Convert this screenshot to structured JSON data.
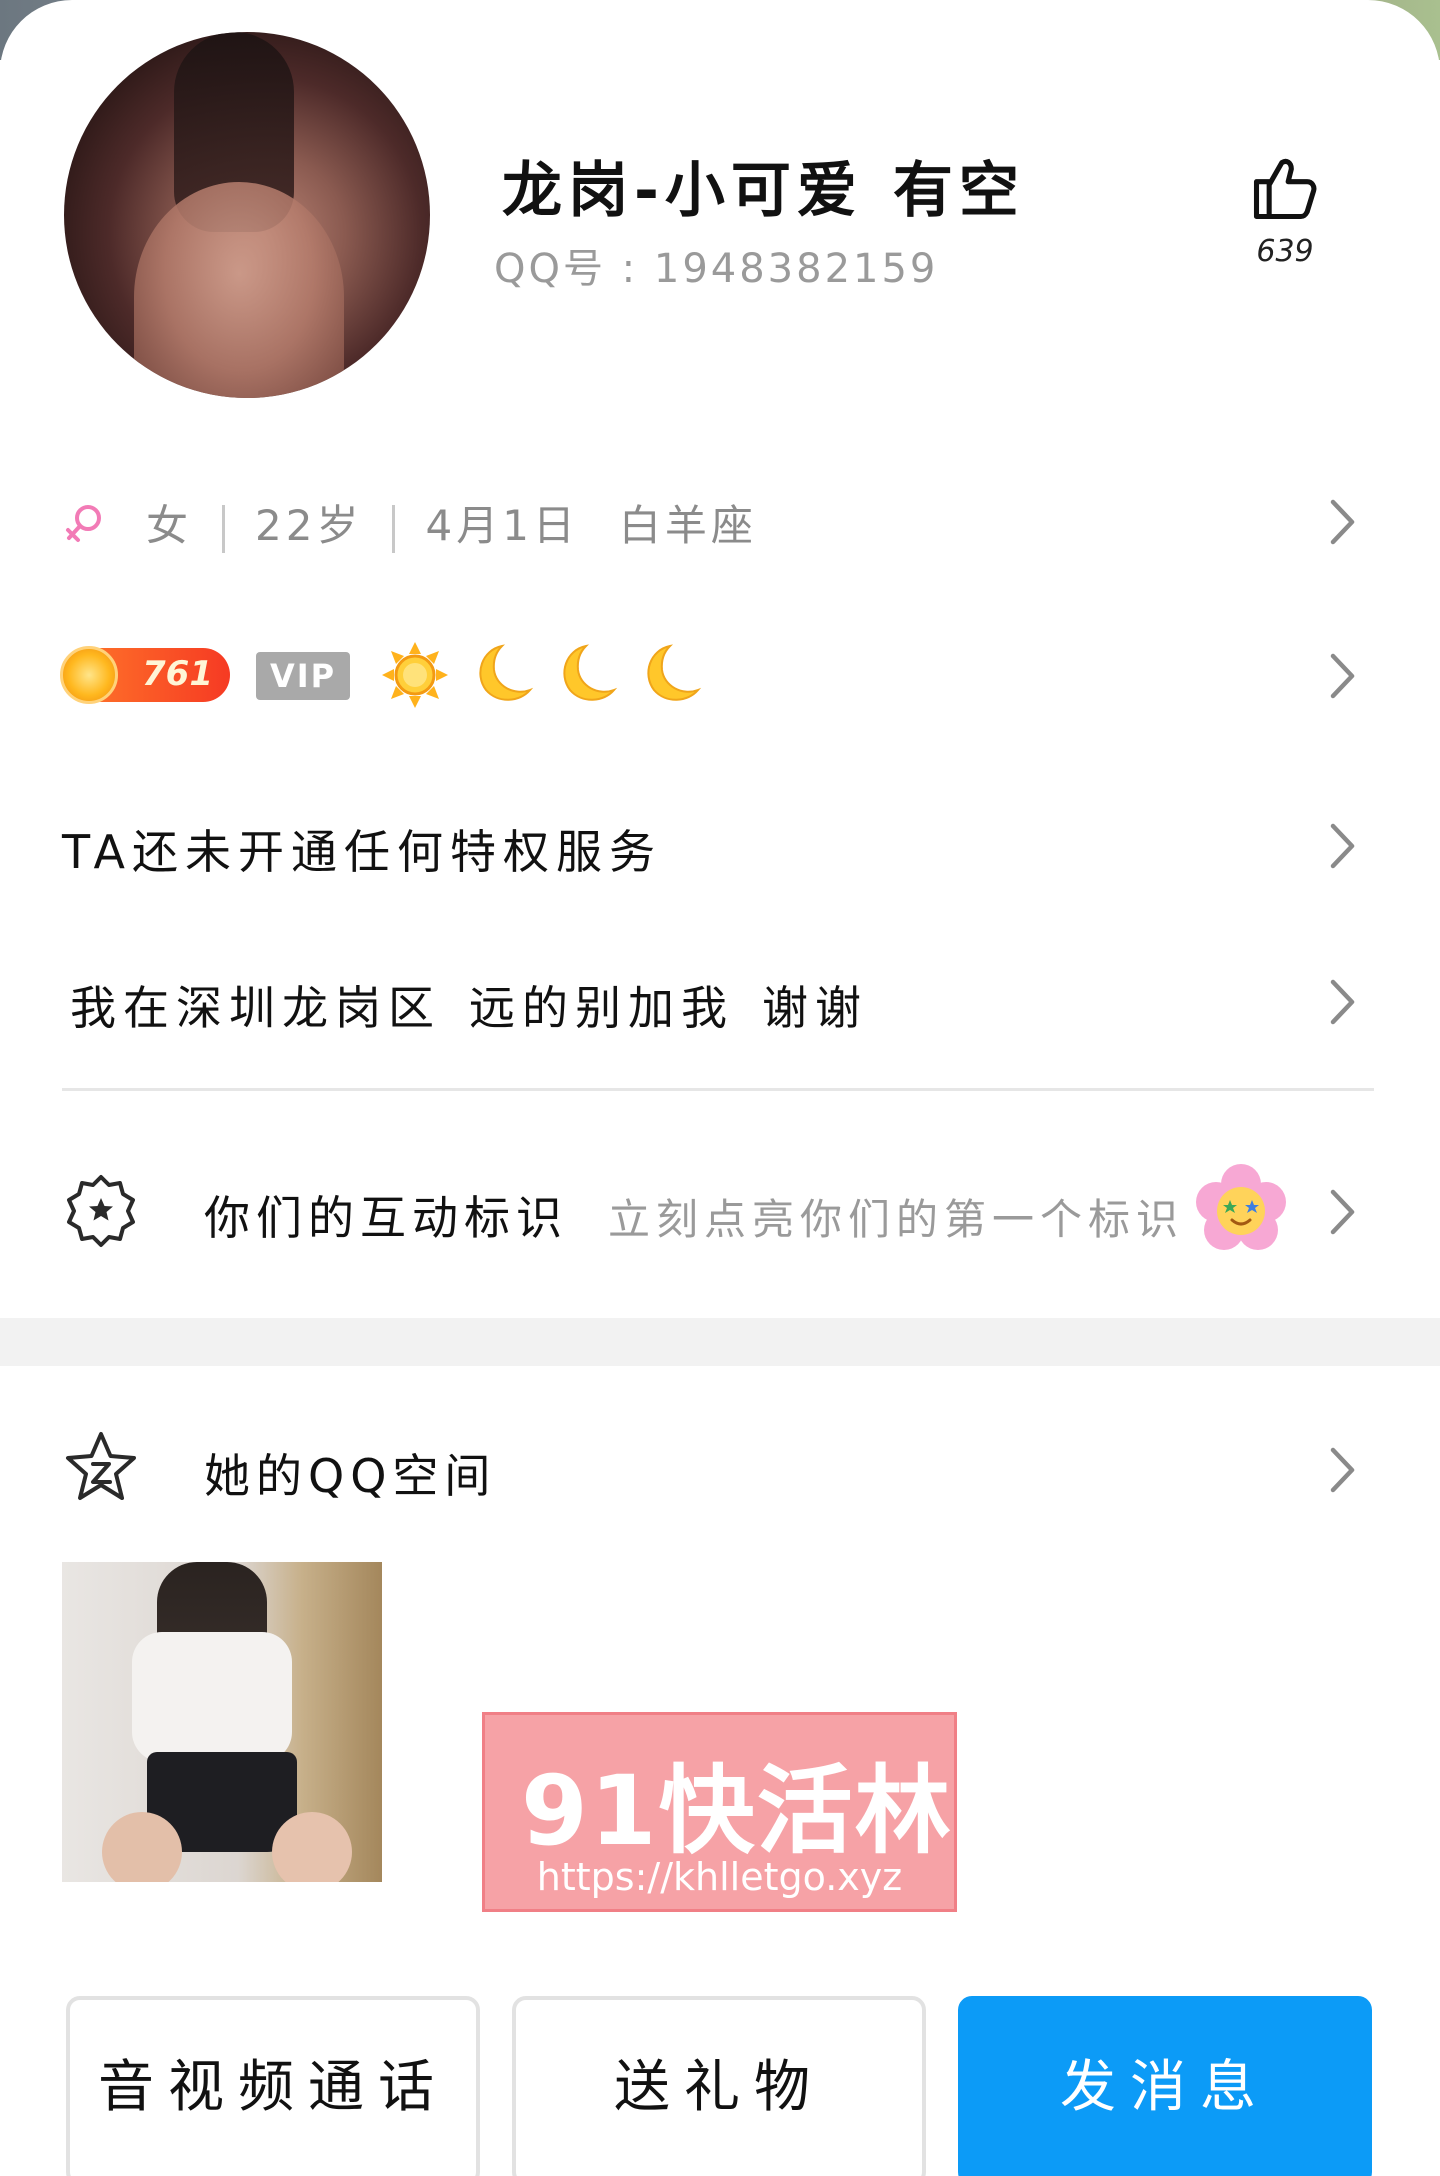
{
  "profile": {
    "name_part1": "龙岗-小可爱",
    "name_part2": "有空",
    "qq_line": "QQ号 : 1948382159",
    "likes": "639"
  },
  "info": {
    "gender": "女",
    "age": "22岁",
    "birthday": "4月1日",
    "zodiac": "白羊座"
  },
  "level": {
    "value": "761",
    "vip_label": "VIP"
  },
  "privilege": {
    "text": "TA还未开通任何特权服务"
  },
  "signature": {
    "part1": "我在深圳龙岗区",
    "part2": "远的别加我",
    "part3": "谢谢"
  },
  "interaction": {
    "title": "你们的互动标识",
    "subtitle": "立刻点亮你们的第一个标识"
  },
  "qzone": {
    "title": "她的QQ空间"
  },
  "watermark": {
    "brand": "91快活林",
    "url": "https://khlletgo.xyz"
  },
  "actions": {
    "call": "音视频通话",
    "gift": "送礼物",
    "message": "发消息"
  },
  "colors": {
    "primary_button": "#0c9bf7",
    "female_icon": "#f27bb6",
    "watermark_bg": "#f6a2a6"
  }
}
